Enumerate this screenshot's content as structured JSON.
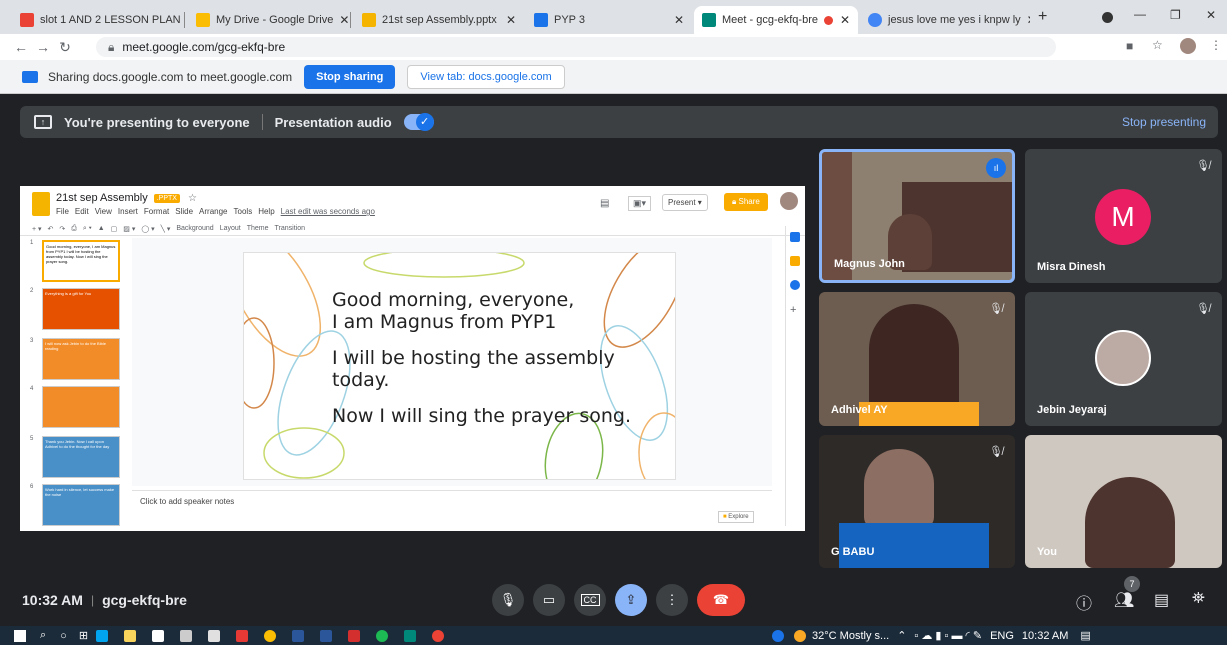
{
  "tabs": [
    {
      "title": "slot 1 AND 2 LESSON PLAN",
      "favicon": "gmail-icon",
      "color": "#ea4335"
    },
    {
      "title": "My Drive - Google Drive",
      "favicon": "drive-icon",
      "color": "#fbbc04"
    },
    {
      "title": "21st sep Assembly.pptx",
      "favicon": "slides-icon",
      "color": "#f4b400"
    },
    {
      "title": "PYP 3",
      "favicon": "meet-icon",
      "color": "#1a73e8"
    },
    {
      "title": "Meet - gcg-ekfq-bre",
      "favicon": "meet-icon",
      "color": "#00897b"
    },
    {
      "title": "jesus love me yes i knpw ly",
      "favicon": "google-icon",
      "color": "#4285f4"
    }
  ],
  "url": "meet.google.com/gcg-ekfq-bre",
  "sharing": {
    "text": "Sharing docs.google.com to meet.google.com",
    "stop_label": "Stop sharing",
    "view_label": "View tab: docs.google.com"
  },
  "presenting": {
    "text": "You're presenting to everyone",
    "audio_label": "Presentation audio",
    "stop_label": "Stop presenting"
  },
  "slides_app": {
    "title": "21st sep Assembly",
    "badge": ".PPTX",
    "menu": [
      "File",
      "Edit",
      "View",
      "Insert",
      "Format",
      "Slide",
      "Arrange",
      "Tools",
      "Help"
    ],
    "last_edit": "Last edit was seconds ago",
    "toolbar": [
      "Background",
      "Layout",
      "Theme",
      "Transition"
    ],
    "present_label": "Present",
    "share_label": "Share",
    "notes_placeholder": "Click to add speaker notes",
    "explore_label": "Explore",
    "slide_lines": [
      "Good morning, everyone,",
      "I am Magnus from PYP1",
      "",
      "I will be hosting the assembly",
      "today.",
      "",
      "Now I will sing the prayer song."
    ],
    "thumbs": [
      {
        "num": "1",
        "text": "Good morning, everyone, I am Magnus from PYP1 I will be hosting the assembly today. Now I will sing the prayer song."
      },
      {
        "num": "2",
        "text": "Everything is a gift for You"
      },
      {
        "num": "3",
        "text": "I will now ask Jebin to do the Bible reading"
      },
      {
        "num": "4",
        "text": ""
      },
      {
        "num": "5",
        "text": "Thank you Jebin. Now I call upon Adhivel to do the thought for the day"
      },
      {
        "num": "6",
        "text": "Work hard in silence, let success make the noise"
      }
    ]
  },
  "participants": [
    {
      "name": "Magnus John",
      "muted": false
    },
    {
      "name": "Misra Dinesh",
      "muted": true,
      "initial": "M"
    },
    {
      "name": "Adhivel AY",
      "muted": true
    },
    {
      "name": "Jebin Jeyaraj",
      "muted": true
    },
    {
      "name": "G BABU",
      "muted": true
    },
    {
      "name": "You",
      "muted": false
    }
  ],
  "meeting": {
    "time": "10:32 AM",
    "code": "gcg-ekfq-bre",
    "participant_count": "7"
  },
  "taskbar": {
    "weather": "32°C Mostly s...",
    "lang": "ENG",
    "clock": "10:32 AM"
  },
  "colors": {
    "meet_bg": "#202124",
    "accent": "#1a73e8",
    "end_call": "#ea4335",
    "avatar_m": "#e91e63"
  }
}
